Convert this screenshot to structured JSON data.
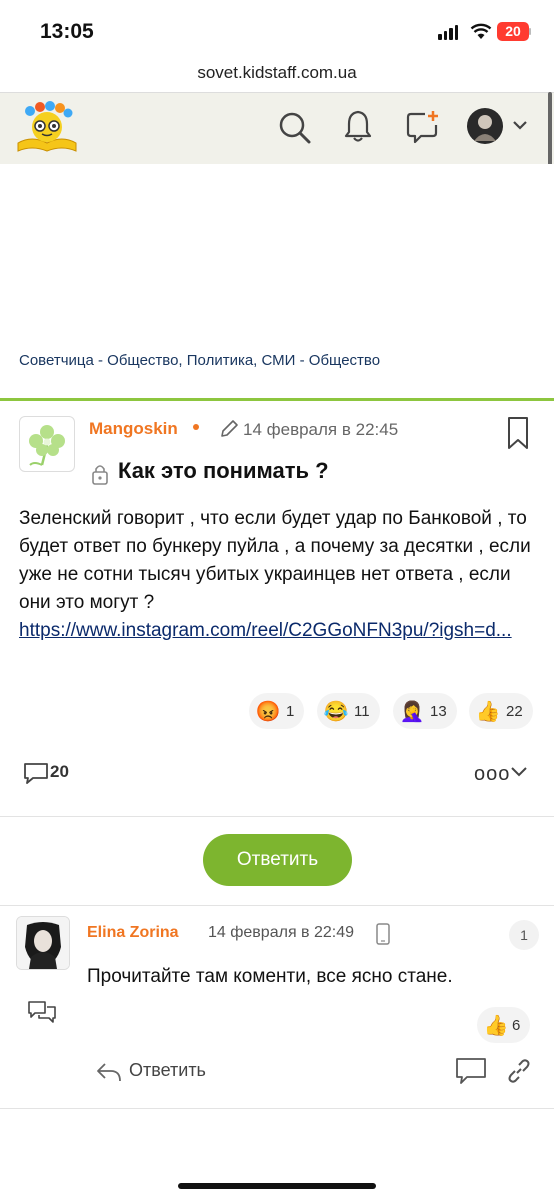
{
  "status": {
    "time": "13:05",
    "battery": "20"
  },
  "browser": {
    "url": "sovet.kidstaff.com.ua"
  },
  "breadcrumb": "Советчица - Общество, Политика, СМИ - Общество",
  "post": {
    "author": "Mangoskin",
    "date": "14 февраля в 22:45",
    "title": "Как это понимать ?",
    "body": "Зеленский говорит , что если будет удар по Банковой , то будет ответ по бункеру пуйла , а почему за десятки , если уже не сотни тысяч убитых украинцев нет ответа , если они это могут ?",
    "link": "https://www.instagram.com/reel/C2GGoNFN3pu/?igsh=d...",
    "reactions": [
      {
        "emoji": "😡",
        "count": "1"
      },
      {
        "emoji": "😂",
        "count": "11"
      },
      {
        "emoji": "🤦‍♀️",
        "count": "13"
      },
      {
        "emoji": "👍",
        "count": "22"
      }
    ],
    "comment_count": "20",
    "more": "ooo"
  },
  "reply_button": "Ответить",
  "comment": {
    "author": "Elina Zorina",
    "date": "14 февраля в 22:49",
    "number": "1",
    "text": "Прочитайте там коменти, все ясно стане.",
    "like_emoji": "👍",
    "like_count": "6",
    "reply_label": "Ответить"
  },
  "colors": {
    "accent_green": "#7db52f",
    "username_orange": "#f07622",
    "header_bg": "#f1f1ea"
  }
}
